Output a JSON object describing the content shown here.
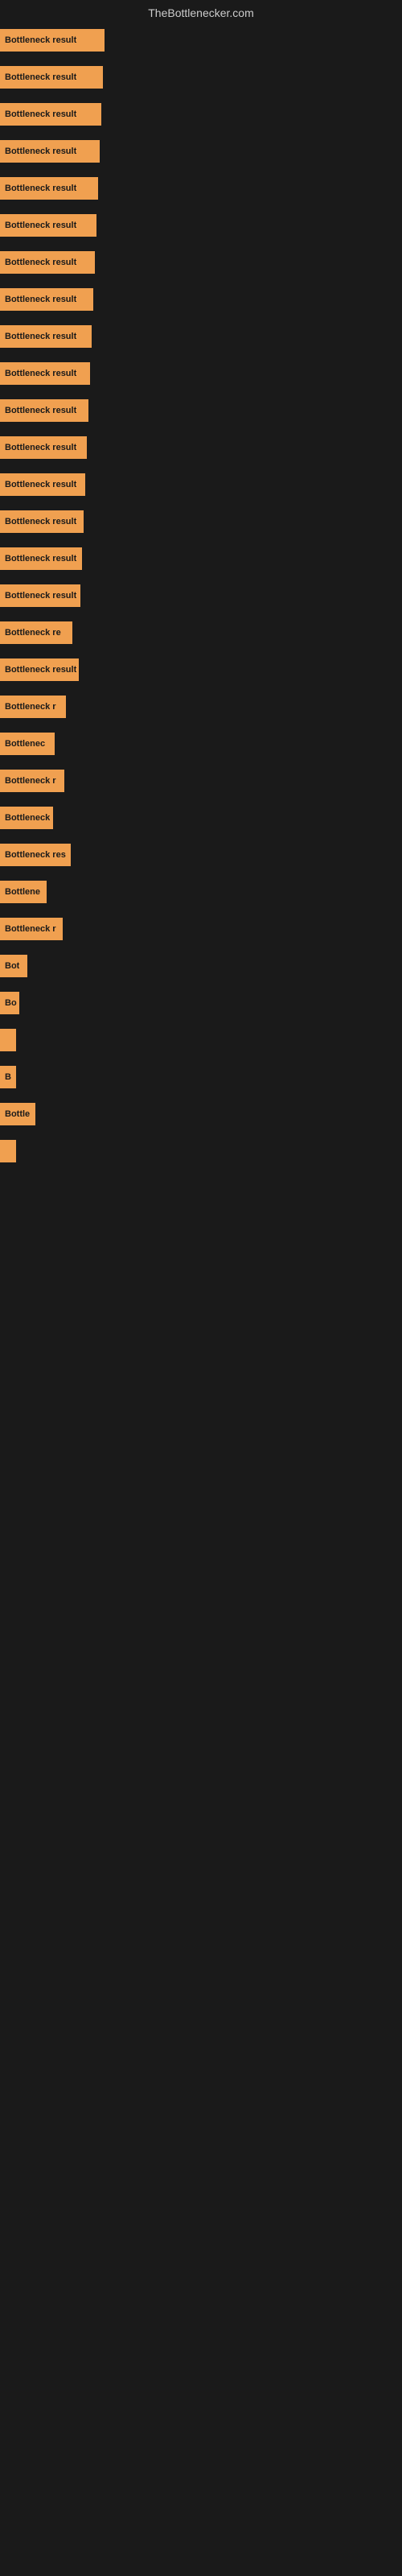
{
  "site_title": "TheBottlenecker.com",
  "bars": [
    {
      "id": 1,
      "label": "Bottleneck result",
      "width": 130
    },
    {
      "id": 2,
      "label": "Bottleneck result",
      "width": 128
    },
    {
      "id": 3,
      "label": "Bottleneck result",
      "width": 126
    },
    {
      "id": 4,
      "label": "Bottleneck result",
      "width": 124
    },
    {
      "id": 5,
      "label": "Bottleneck result",
      "width": 122
    },
    {
      "id": 6,
      "label": "Bottleneck result",
      "width": 120
    },
    {
      "id": 7,
      "label": "Bottleneck result",
      "width": 118
    },
    {
      "id": 8,
      "label": "Bottleneck result",
      "width": 116
    },
    {
      "id": 9,
      "label": "Bottleneck result",
      "width": 114
    },
    {
      "id": 10,
      "label": "Bottleneck result",
      "width": 112
    },
    {
      "id": 11,
      "label": "Bottleneck result",
      "width": 110
    },
    {
      "id": 12,
      "label": "Bottleneck result",
      "width": 108
    },
    {
      "id": 13,
      "label": "Bottleneck result",
      "width": 106
    },
    {
      "id": 14,
      "label": "Bottleneck result",
      "width": 104
    },
    {
      "id": 15,
      "label": "Bottleneck result",
      "width": 102
    },
    {
      "id": 16,
      "label": "Bottleneck result",
      "width": 100
    },
    {
      "id": 17,
      "label": "Bottleneck re",
      "width": 90
    },
    {
      "id": 18,
      "label": "Bottleneck result",
      "width": 98
    },
    {
      "id": 19,
      "label": "Bottleneck r",
      "width": 82
    },
    {
      "id": 20,
      "label": "Bottlenec",
      "width": 68
    },
    {
      "id": 21,
      "label": "Bottleneck r",
      "width": 80
    },
    {
      "id": 22,
      "label": "Bottleneck",
      "width": 66
    },
    {
      "id": 23,
      "label": "Bottleneck res",
      "width": 88
    },
    {
      "id": 24,
      "label": "Bottlene",
      "width": 58
    },
    {
      "id": 25,
      "label": "Bottleneck r",
      "width": 78
    },
    {
      "id": 26,
      "label": "Bot",
      "width": 34
    },
    {
      "id": 27,
      "label": "Bo",
      "width": 24
    },
    {
      "id": 28,
      "label": "",
      "width": 8
    },
    {
      "id": 29,
      "label": "B",
      "width": 16
    },
    {
      "id": 30,
      "label": "Bottle",
      "width": 44
    },
    {
      "id": 31,
      "label": "",
      "width": 6
    },
    {
      "id": 32,
      "label": "",
      "width": 0
    },
    {
      "id": 33,
      "label": "",
      "width": 0
    },
    {
      "id": 34,
      "label": "",
      "width": 0
    },
    {
      "id": 35,
      "label": "",
      "width": 0
    },
    {
      "id": 36,
      "label": "",
      "width": 0
    },
    {
      "id": 37,
      "label": "",
      "width": 0
    },
    {
      "id": 38,
      "label": "",
      "width": 0
    },
    {
      "id": 39,
      "label": "",
      "width": 0
    },
    {
      "id": 40,
      "label": "",
      "width": 0
    }
  ]
}
